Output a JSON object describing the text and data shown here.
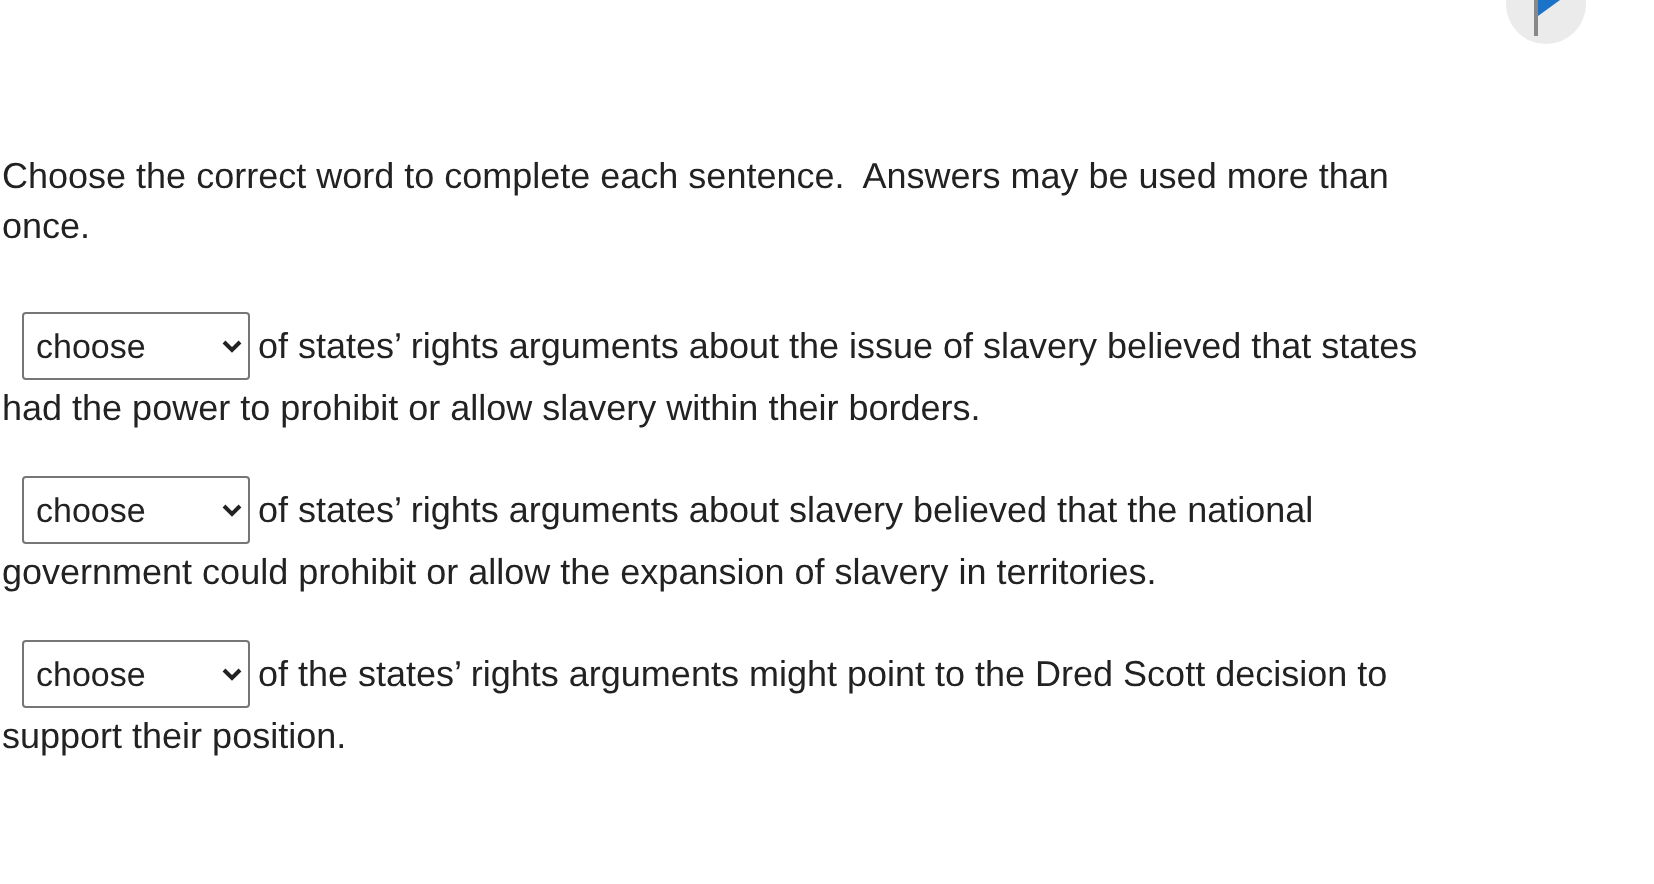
{
  "instructions": "Choose the correct word to complete each sentence.  Answers may be used more than once.",
  "questions": [
    {
      "select": {
        "value": "choose"
      },
      "lines": [
        "of states’ rights arguments about the issue of slavery believed that states",
        "had the power to prohibit or allow slavery within their borders."
      ]
    },
    {
      "select": {
        "value": "choose"
      },
      "lines": [
        "of states’ rights arguments about slavery believed that the national",
        "government could prohibit or allow the expansion of slavery in territories."
      ]
    },
    {
      "select": {
        "value": "choose"
      },
      "lines": [
        "of the states’ rights arguments might point to the Dred Scott decision to",
        "support their position."
      ]
    }
  ]
}
